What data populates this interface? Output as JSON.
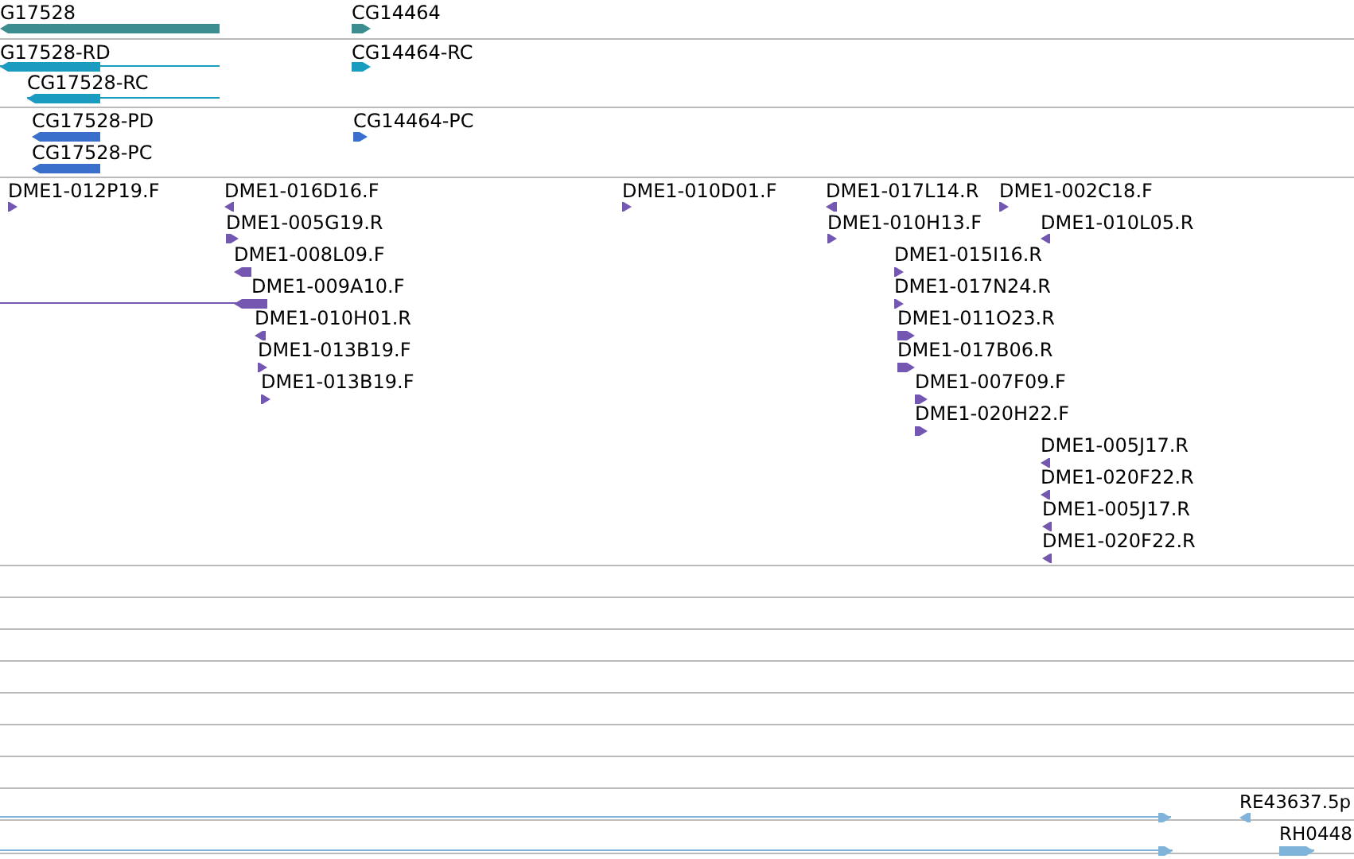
{
  "tracks": [
    {
      "color": "#3c8d8f",
      "features": [
        {
          "label": "G17528",
          "reverse": true
        },
        {
          "label": "CG14464",
          "reverse": false
        }
      ]
    },
    {
      "color": "#1a9bc0",
      "features": [
        {
          "label": "G17528-RD",
          "reverse": true
        },
        {
          "label": "CG17528-RC",
          "reverse": true
        },
        {
          "label": "CG14464-RC",
          "reverse": false
        }
      ]
    },
    {
      "color": "#3a6fcc",
      "features": [
        {
          "label": "CG17528-PD",
          "reverse": true
        },
        {
          "label": "CG17528-PC",
          "reverse": true
        },
        {
          "label": "CG14464-PC",
          "reverse": false
        }
      ]
    },
    {
      "color": "#7457b0",
      "features": [
        {
          "label": "DME1-012P19.F",
          "reverse": false
        },
        {
          "label": "DME1-016D16.F",
          "reverse": true
        },
        {
          "label": "DME1-005G19.R",
          "reverse": false
        },
        {
          "label": "DME1-008L09.F",
          "reverse": true
        },
        {
          "label": "DME1-009A10.F",
          "reverse": true
        },
        {
          "label": "DME1-010H01.R",
          "reverse": true
        },
        {
          "label": "DME1-013B19.F",
          "reverse": false
        },
        {
          "label": "DME1-013B19.F",
          "reverse": false
        },
        {
          "label": "DME1-010D01.F",
          "reverse": false
        },
        {
          "label": "DME1-017L14.R",
          "reverse": true
        },
        {
          "label": "DME1-002C18.F",
          "reverse": false
        },
        {
          "label": "DME1-010H13.F",
          "reverse": false
        },
        {
          "label": "DME1-010L05.R",
          "reverse": true
        },
        {
          "label": "DME1-015I16.R",
          "reverse": false
        },
        {
          "label": "DME1-017N24.R",
          "reverse": false
        },
        {
          "label": "DME1-011O23.R",
          "reverse": false
        },
        {
          "label": "DME1-017B06.R",
          "reverse": false
        },
        {
          "label": "DME1-007F09.F",
          "reverse": false
        },
        {
          "label": "DME1-020H22.F",
          "reverse": false
        },
        {
          "label": "DME1-005J17.R",
          "reverse": true
        },
        {
          "label": "DME1-020F22.R",
          "reverse": true
        },
        {
          "label": "DME1-005J17.R",
          "reverse": true
        },
        {
          "label": "DME1-020F22.R",
          "reverse": true
        }
      ]
    },
    {
      "color": "#80b3da",
      "features": [
        {
          "reverse": false
        },
        {
          "label": "RE43637.5p",
          "reverse": true
        }
      ]
    },
    {
      "color": "#80b3da",
      "features": [
        {
          "reverse": false
        },
        {
          "label": "RH0448",
          "reverse": false
        }
      ]
    }
  ]
}
